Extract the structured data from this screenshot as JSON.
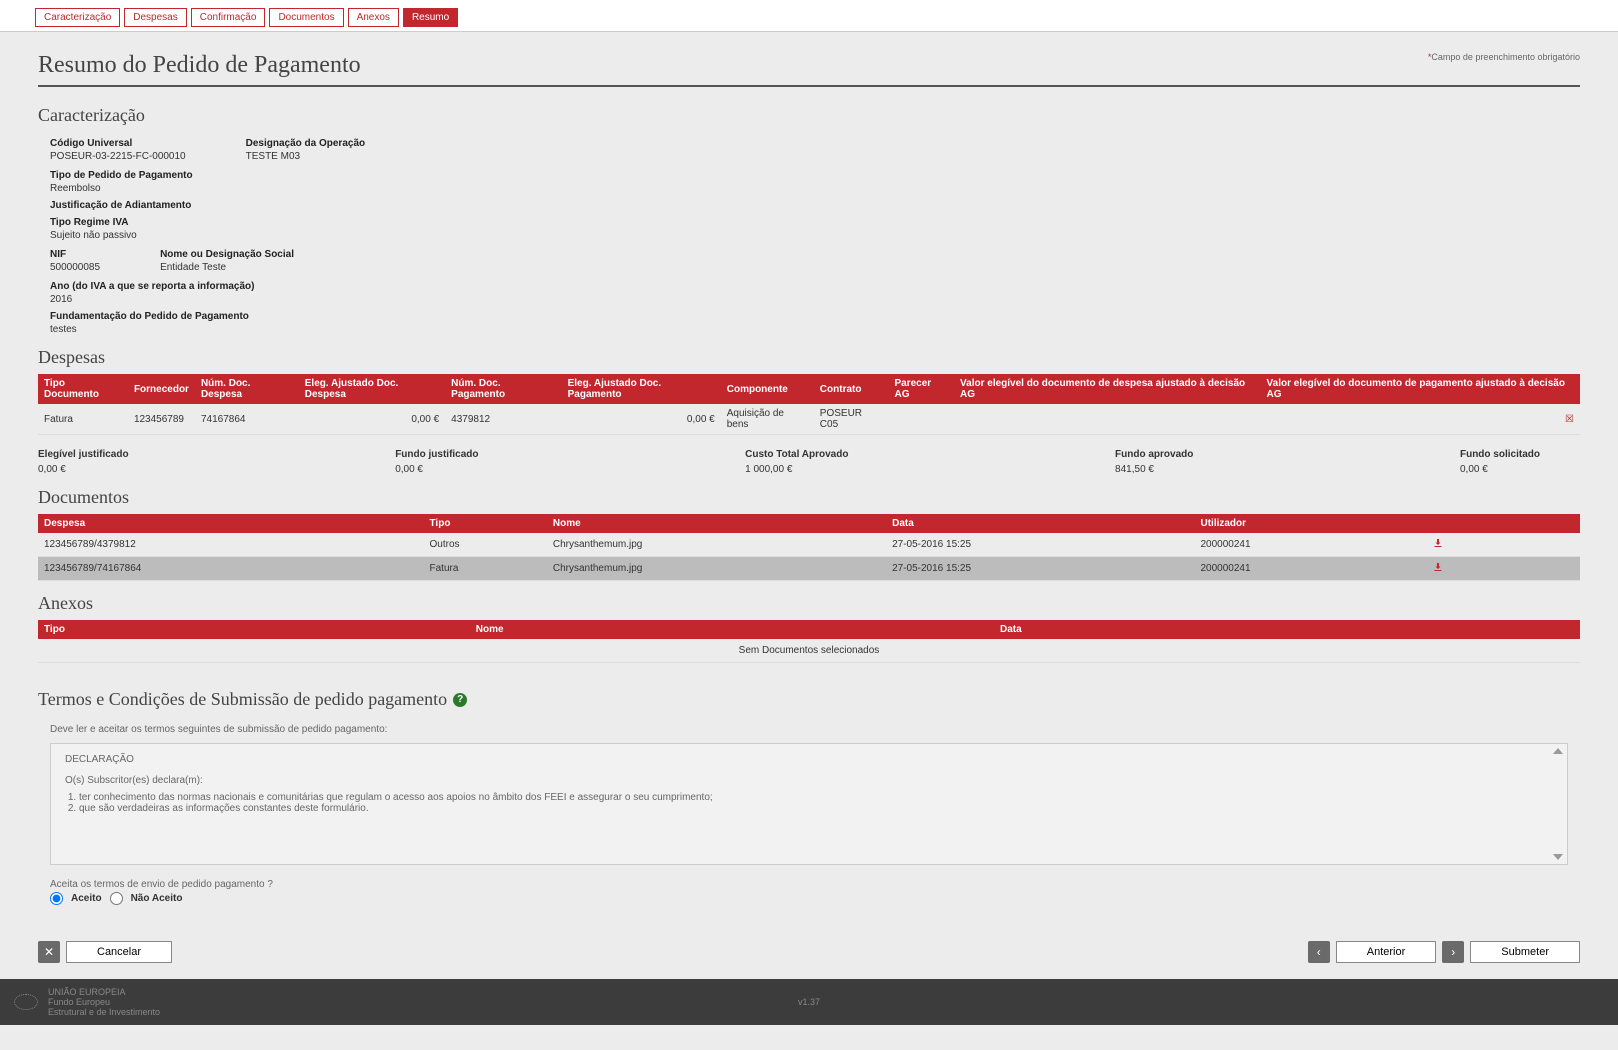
{
  "tabs": [
    "Caracterização",
    "Despesas",
    "Confirmação",
    "Documentos",
    "Anexos",
    "Resumo"
  ],
  "active_tab": 5,
  "page_title": "Resumo do Pedido de Pagamento",
  "required_note": "Campo de preenchimento obrigatório",
  "sections": {
    "caracterizacao": {
      "title": "Caracterização",
      "codigo_universal_label": "Código Universal",
      "codigo_universal": "POSEUR-03-2215-FC-000010",
      "designacao_label": "Designação da Operação",
      "designacao": "TESTE M03",
      "tipo_pedido_label": "Tipo de Pedido de Pagamento",
      "tipo_pedido": "Reembolso",
      "justificacao_label": "Justificação de Adiantamento",
      "justificacao": "",
      "regime_iva_label": "Tipo Regime IVA",
      "regime_iva": "Sujeito não passivo",
      "nif_label": "NIF",
      "nif": "500000085",
      "nome_social_label": "Nome ou Designação Social",
      "nome_social": "Entidade Teste",
      "ano_iva_label": "Ano (do IVA a que se reporta a informação)",
      "ano_iva": "2016",
      "fundamentacao_label": "Fundamentação do Pedido de Pagamento",
      "fundamentacao": "testes"
    },
    "despesas": {
      "title": "Despesas",
      "headers": [
        "Tipo Documento",
        "Fornecedor",
        "Núm. Doc. Despesa",
        "Eleg. Ajustado Doc. Despesa",
        "Núm. Doc. Pagamento",
        "Eleg. Ajustado Doc. Pagamento",
        "Componente",
        "Contrato",
        "Parecer AG",
        "Valor elegível do documento de despesa ajustado à decisão AG",
        "Valor elegível do documento de pagamento ajustado à decisão AG"
      ],
      "rows": [
        {
          "tipo": "Fatura",
          "fornecedor": "123456789",
          "num_despesa": "74167864",
          "eleg_despesa": "0,00 €",
          "num_pagamento": "4379812",
          "eleg_pagamento": "0,00 €",
          "componente": "Aquisição de bens",
          "contrato": "POSEUR C05",
          "parecer": "",
          "val_despesa": "",
          "val_pagamento": ""
        }
      ],
      "totals": [
        {
          "label": "Elegível justificado",
          "value": "0,00 €"
        },
        {
          "label": "Fundo justificado",
          "value": "0,00 €"
        },
        {
          "label": "Custo Total Aprovado",
          "value": "1 000,00 €"
        },
        {
          "label": "Fundo aprovado",
          "value": "841,50 €"
        },
        {
          "label": "Fundo solicitado",
          "value": "0,00 €"
        }
      ]
    },
    "documentos": {
      "title": "Documentos",
      "headers": [
        "Despesa",
        "Tipo",
        "Nome",
        "Data",
        "Utilizador",
        ""
      ],
      "rows": [
        {
          "despesa": "123456789/4379812",
          "tipo": "Outros",
          "nome": "Chrysanthemum.jpg",
          "data": "27-05-2016 15:25",
          "utilizador": "200000241"
        },
        {
          "despesa": "123456789/74167864",
          "tipo": "Fatura",
          "nome": "Chrysanthemum.jpg",
          "data": "27-05-2016 15:25",
          "utilizador": "200000241"
        }
      ]
    },
    "anexos": {
      "title": "Anexos",
      "headers": [
        "Tipo",
        "Nome",
        "Data"
      ],
      "empty": "Sem Documentos selecionados"
    },
    "termos": {
      "title": "Termos e Condições de Submissão de pedido pagamento",
      "note": "Deve ler e aceitar os termos seguintes de submissão de pedido pagamento:",
      "declaracao_title": "DECLARAÇÃO",
      "declaracao_sub": "O(s) Subscritor(es) declara(m):",
      "items": [
        "ter conhecimento das normas nacionais e comunitárias que regulam o acesso aos apoios no âmbito dos FEEI e assegurar o seu cumprimento;",
        "que são verdadeiras as informações constantes deste formulário."
      ],
      "question": "Aceita os termos de envio de pedido pagamento ?",
      "aceito": "Aceito",
      "nao_aceito": "Não Aceito"
    }
  },
  "actions": {
    "cancelar": "Cancelar",
    "anterior": "Anterior",
    "submeter": "Submeter"
  },
  "footer": {
    "line1": "UNIÃO EUROPEIA",
    "line2": "Fundo Europeu",
    "line3": "Estrutural e de Investimento",
    "version": "v1.37"
  }
}
